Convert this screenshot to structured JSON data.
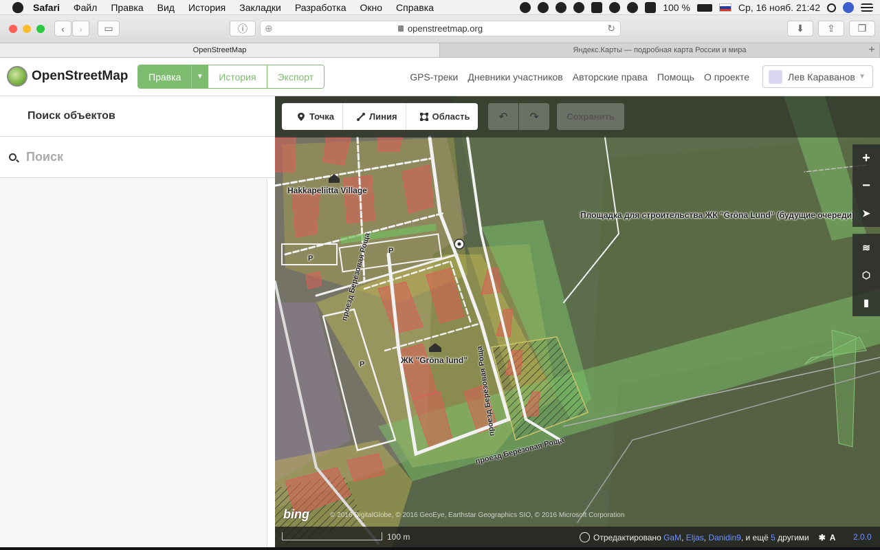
{
  "menubar": {
    "app": "Safari",
    "items": [
      "Файл",
      "Правка",
      "Вид",
      "История",
      "Закладки",
      "Разработка",
      "Окно",
      "Справка"
    ],
    "battery": "100 %",
    "datetime": "Ср, 16 нояб.  21:42"
  },
  "browser": {
    "url": "openstreetmap.org",
    "tabs": [
      "OpenStreetMap",
      "Яндекс.Карты — подробная карта России и мира"
    ]
  },
  "osm": {
    "logo": "OpenStreetMap",
    "edit_label": "Правка",
    "history_label": "История",
    "export_label": "Экспорт",
    "nav": [
      "GPS-треки",
      "Дневники участников",
      "Авторские права",
      "Помощь",
      "О проекте"
    ],
    "user": "Лев Караванов"
  },
  "sidebar": {
    "title": "Поиск объектов",
    "search_placeholder": "Поиск"
  },
  "editor": {
    "modes": [
      "Точка",
      "Линия",
      "Область"
    ],
    "save_label": "Сохранить",
    "labels": {
      "village": "Hakkapeliitta Village",
      "site": "Площадка для строительства ЖК \"Grōna Lund\" (будущие очереди)",
      "complex": "ЖК \"Grōna lund\"",
      "road1": "проезд Берёзовая Роща",
      "road2": "проезд Берёзовая Роща",
      "road3": "проезд Берёзовая Роща",
      "parking": "P"
    },
    "scale": "100 m",
    "attribution_prefix": "Отредактировано",
    "editors": [
      "GaM",
      "Eljas",
      "Danidin9"
    ],
    "attribution_more": ", и ещё",
    "others_count": "5",
    "attribution_suffix": "другими",
    "version": "2.0.0",
    "bing": "bing",
    "imagery_credit": "© 2016 DigitalGlobe, © 2016 GeoEye, Earthstar Geographics SIO, © 2016 Microsoft Corporation"
  }
}
